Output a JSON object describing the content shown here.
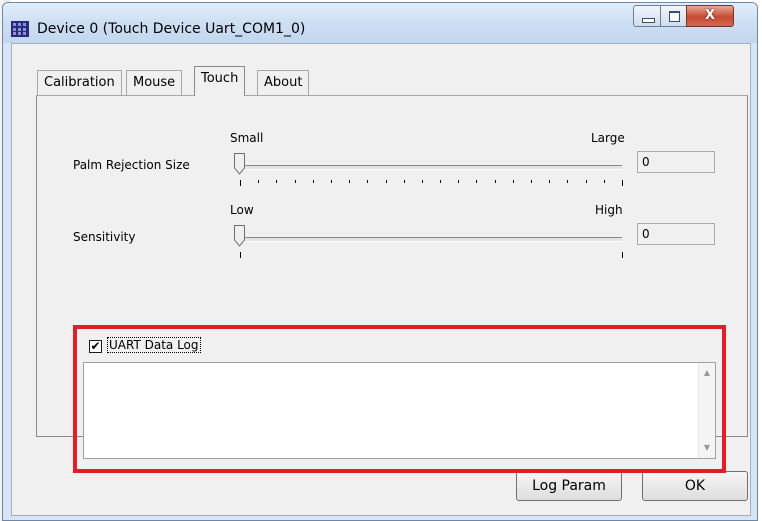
{
  "window": {
    "title": "Device 0 (Touch Device Uart_COM1_0)",
    "icon": "grid-app-icon",
    "controls": {
      "minimize": "minimize-icon",
      "maximize": "maximize-icon",
      "close": "X"
    }
  },
  "tabs": [
    {
      "label": "Calibration",
      "active": false
    },
    {
      "label": "Mouse",
      "active": false
    },
    {
      "label": "Touch",
      "active": true
    },
    {
      "label": "About",
      "active": false
    }
  ],
  "palm": {
    "label": "Palm Rejection Size",
    "min_label": "Small",
    "max_label": "Large",
    "value": "0",
    "slider_level": 0
  },
  "sensitivity": {
    "label": "Sensitivity",
    "min_label": "Low",
    "max_label": "High",
    "value": "0",
    "slider_level": 0
  },
  "uart_log": {
    "checkbox_label": "UART Data Log",
    "checked": true,
    "checkmark": "✔",
    "text": "",
    "scroll_up": "▲",
    "scroll_down": "▼",
    "highlight_color": "#e41e26"
  },
  "buttons": {
    "log_param": "Log Param",
    "ok": "OK"
  }
}
